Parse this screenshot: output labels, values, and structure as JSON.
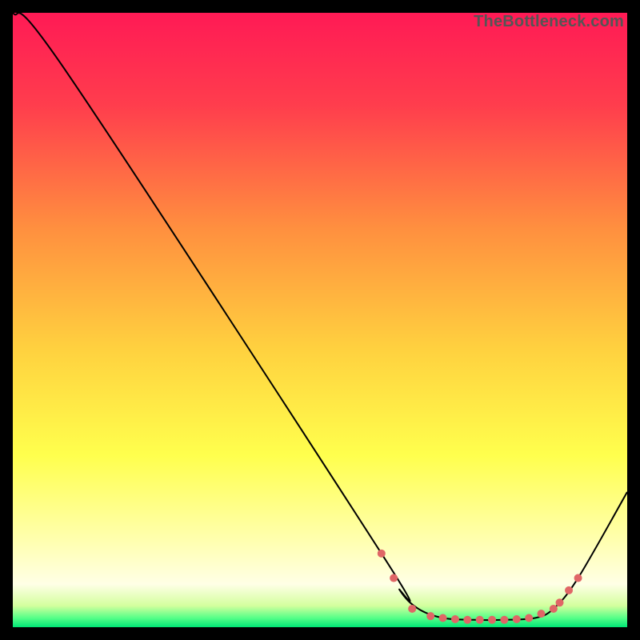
{
  "watermark": "TheBottleneck.com",
  "chart_data": {
    "type": "line",
    "title": "",
    "xlabel": "",
    "ylabel": "",
    "xlim": [
      0,
      100
    ],
    "ylim": [
      0,
      100
    ],
    "grid": false,
    "legend": false,
    "gradient_stops": [
      {
        "t": 0.0,
        "color": "#ff1a55"
      },
      {
        "t": 0.15,
        "color": "#ff3d4d"
      },
      {
        "t": 0.35,
        "color": "#ff8f3f"
      },
      {
        "t": 0.55,
        "color": "#ffd23f"
      },
      {
        "t": 0.72,
        "color": "#ffff4d"
      },
      {
        "t": 0.86,
        "color": "#ffffb0"
      },
      {
        "t": 0.93,
        "color": "#ffffe6"
      },
      {
        "t": 0.965,
        "color": "#d4ff9e"
      },
      {
        "t": 0.985,
        "color": "#55ff88"
      },
      {
        "t": 1.0,
        "color": "#00e676"
      }
    ],
    "series": [
      {
        "name": "bottleneck-curve",
        "color": "#000000",
        "x": [
          0,
          9,
          60,
          63,
          66,
          70,
          75,
          80,
          85,
          88,
          92,
          100
        ],
        "y": [
          100,
          90,
          12,
          6,
          3,
          1.5,
          1.2,
          1.2,
          1.5,
          3,
          8,
          22
        ]
      }
    ],
    "scatter": {
      "name": "highlight-points",
      "color": "#e06666",
      "radius": 5,
      "points": [
        {
          "x": 60,
          "y": 12
        },
        {
          "x": 62,
          "y": 8
        },
        {
          "x": 65,
          "y": 3
        },
        {
          "x": 68,
          "y": 1.8
        },
        {
          "x": 70,
          "y": 1.5
        },
        {
          "x": 72,
          "y": 1.3
        },
        {
          "x": 74,
          "y": 1.2
        },
        {
          "x": 76,
          "y": 1.2
        },
        {
          "x": 78,
          "y": 1.2
        },
        {
          "x": 80,
          "y": 1.2
        },
        {
          "x": 82,
          "y": 1.3
        },
        {
          "x": 84,
          "y": 1.5
        },
        {
          "x": 86,
          "y": 2.2
        },
        {
          "x": 88,
          "y": 3
        },
        {
          "x": 89,
          "y": 4
        },
        {
          "x": 90.5,
          "y": 6
        },
        {
          "x": 92,
          "y": 8
        }
      ]
    }
  }
}
